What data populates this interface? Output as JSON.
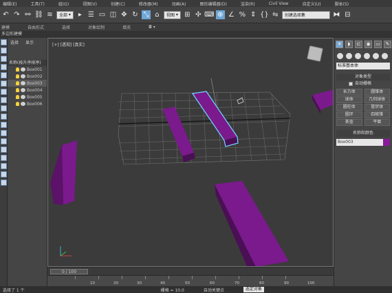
{
  "menu": [
    "编辑(E)",
    "工具(T)",
    "组(G)",
    "视图(V)",
    "创建(C)",
    "修改器(M)",
    "动画(A)",
    "图形编辑器(D)",
    "渲染(R)",
    "Civil View",
    "自定义(U)",
    "脚本(S)"
  ],
  "toolbar": {
    "selection_filter": "全部",
    "view_dropdown": "视图",
    "named_selection": "创建选择集"
  },
  "ribbon": {
    "items": [
      "建模",
      "自由形式",
      "选择",
      "对象绘制",
      "填充"
    ],
    "sub_label": "多边形建模"
  },
  "explorer": {
    "tabs": [
      "选择",
      "显示"
    ],
    "header": "名称(按升序排序)",
    "items": [
      "Box001",
      "Box002",
      "Box003",
      "Box004",
      "Box005",
      "Box006"
    ],
    "selected": "Box003"
  },
  "viewport": {
    "label": "[+] [透视] [真实]"
  },
  "command_panel": {
    "category": "标准基本体",
    "object_type_title": "对象类型",
    "autogrid": "自动栅格",
    "object_buttons": [
      "长方体",
      "圆锥体",
      "球体",
      "几何球体",
      "圆柱体",
      "管状体",
      "圆环",
      "四棱锥",
      "茶壶",
      "平面"
    ],
    "name_color_title": "名称和颜色",
    "object_name": "Box003",
    "object_color": "#8a1a9a"
  },
  "timeline": {
    "slider_label": "0 / 100",
    "ticks": [
      "10",
      "20",
      "30",
      "40",
      "50",
      "60",
      "70",
      "80",
      "90",
      "100"
    ]
  },
  "status": {
    "left": "选择了 1 个",
    "grid": "栅格 = 10.0",
    "autokey": "自动关键点",
    "selected_obj": "选定对象"
  },
  "colors": {
    "box": "#7a1a8c",
    "box_dark": "#4a0f55",
    "selection": "#6fd0ff",
    "accent": "#6fa6d6"
  }
}
